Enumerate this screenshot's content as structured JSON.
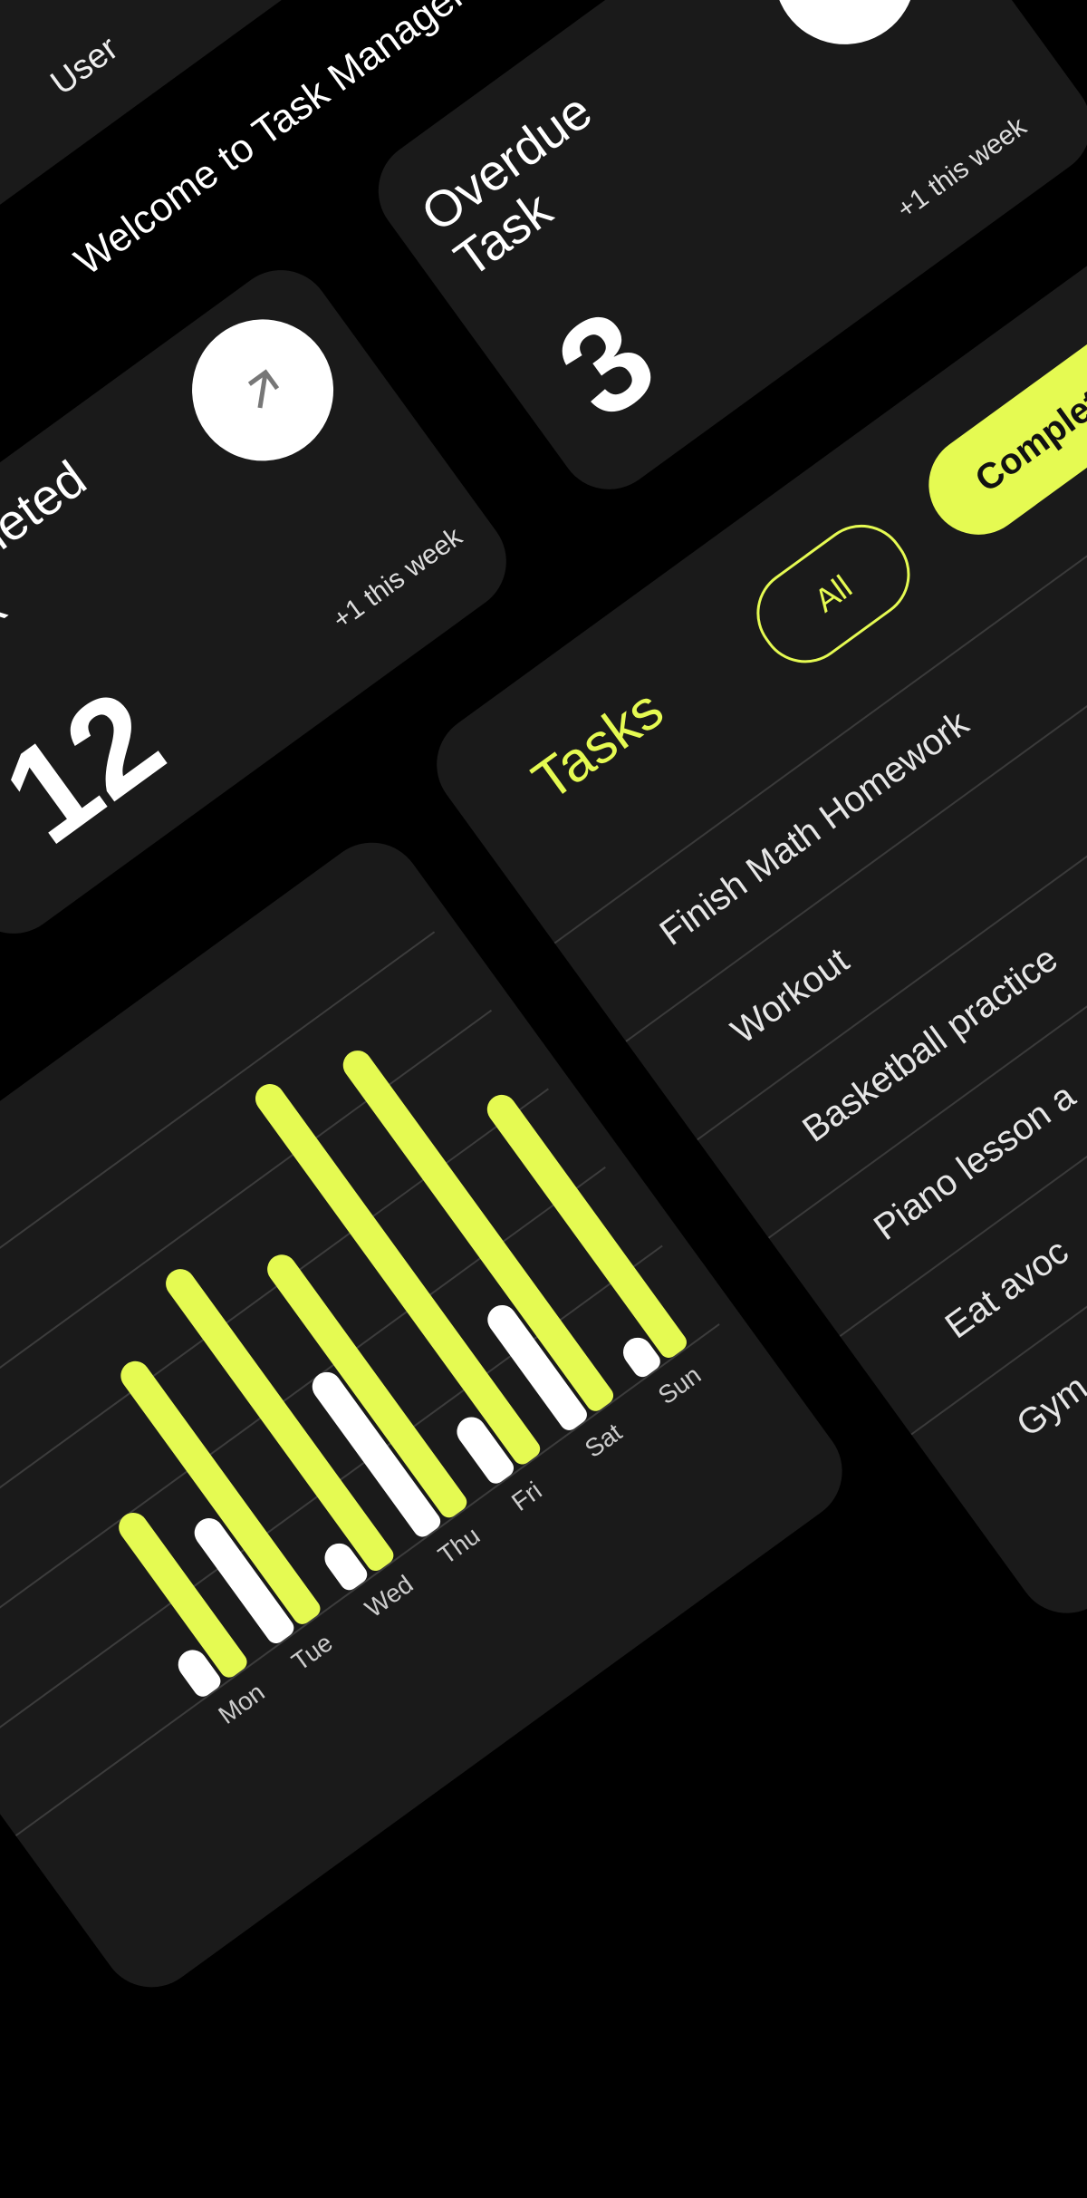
{
  "header": {
    "user_label": "User",
    "welcome": "Welcome to Task Manager"
  },
  "cards": [
    {
      "title_line1": "Completed",
      "title_line2": "Task",
      "value": "12",
      "delta": "+1 this week",
      "icon": "arrow-up-right-icon"
    },
    {
      "title_line1": "Overdue",
      "title_line2": "Task",
      "value": "3",
      "delta": "+1 this week",
      "icon": "arrow-up-right-icon"
    }
  ],
  "tasks": {
    "title": "Tasks",
    "filters": [
      {
        "label": "All",
        "active": false
      },
      {
        "label": "Completed",
        "active": true
      }
    ],
    "items": [
      "Finish Math Homework",
      "Workout",
      "Basketball practice",
      "Piano lesson a",
      "Eat avoc",
      "Gym"
    ]
  },
  "colors": {
    "accent": "#e5fa52",
    "card": "#1a1a1a",
    "background": "#000000",
    "secondary": "#ffffff"
  },
  "chart_data": {
    "type": "bar",
    "categories": [
      "Mon",
      "Tue",
      "Wed",
      "Thu",
      "Fri",
      "Sat",
      "Sun"
    ],
    "series": [
      {
        "name": "secondary",
        "color": "#ffffff",
        "values": [
          1,
          3,
          1,
          4,
          1.5,
          3,
          0.8
        ]
      },
      {
        "name": "primary",
        "color": "#e5fa52",
        "values": [
          4,
          6.5,
          7.5,
          6.5,
          9.5,
          9,
          6.5
        ]
      }
    ],
    "ylim": [
      0,
      10
    ],
    "grid": true
  }
}
